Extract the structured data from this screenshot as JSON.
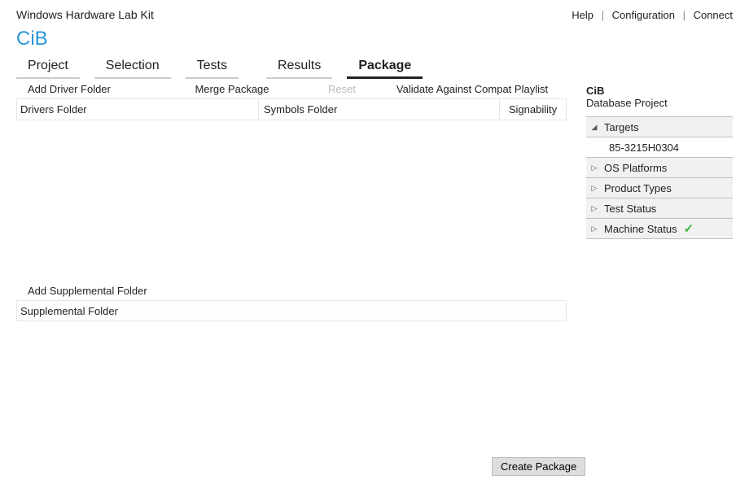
{
  "header": {
    "app_title": "Windows Hardware Lab Kit",
    "links": {
      "help": "Help",
      "config": "Configuration",
      "connect": "Connect"
    }
  },
  "project_label": "CiB",
  "tabs": {
    "project": "Project",
    "selection": "Selection",
    "tests": "Tests",
    "results": "Results",
    "package": "Package"
  },
  "toolbar": {
    "add_driver": "Add Driver Folder",
    "merge": "Merge Package",
    "reset": "Reset",
    "validate": "Validate Against Compat Playlist"
  },
  "columns": {
    "drivers": "Drivers Folder",
    "symbols": "Symbols Folder",
    "signability": "Signability"
  },
  "supplemental": {
    "add_label": "Add Supplemental Folder",
    "col": "Supplemental Folder"
  },
  "buttons": {
    "create": "Create Package"
  },
  "sidebar": {
    "title": "CiB",
    "subtitle": "Database Project",
    "rows": {
      "targets": "Targets",
      "target_item": "85-3215H0304",
      "os": "OS Platforms",
      "product": "Product Types",
      "test": "Test Status",
      "machine": "Machine Status"
    }
  }
}
